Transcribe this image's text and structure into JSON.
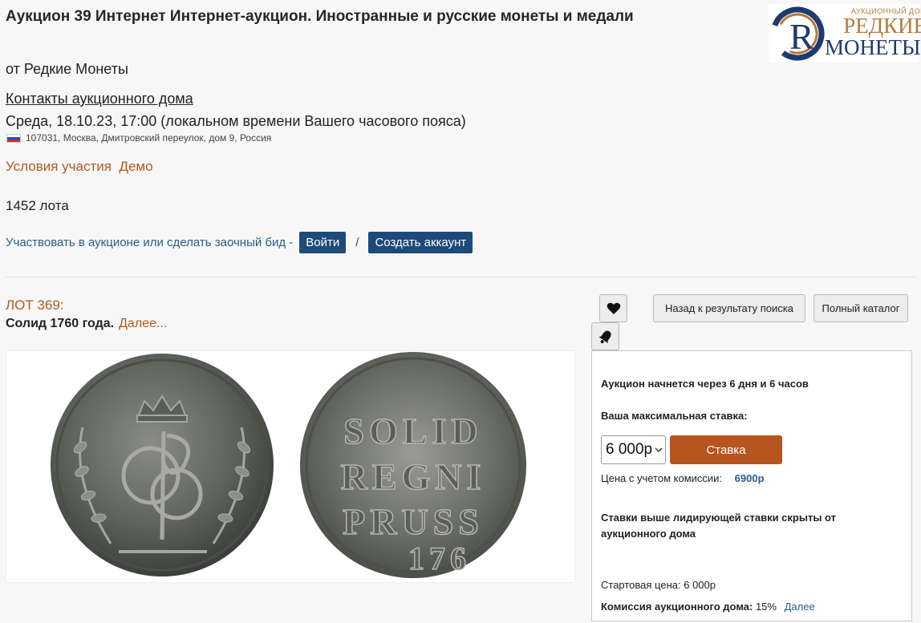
{
  "auction": {
    "title": "Аукцион 39 Интернет Интернет-аукцион. Иностранные и русские монеты и медали",
    "by": "от Редкие Монеты",
    "contacts_link": "Контакты аукционного дома",
    "date": "Среда, 18.10.23, 17:00 (локальном времени Вашего часового пояса)",
    "address": "107031, Москва, Дмитровский переулок, дом 9, Россия",
    "terms_link": "Условия участия",
    "demo_link": "Демо",
    "lots_count": "1452 лота",
    "participate_text": "Участвовать в аукционе или сделать заочный бид -",
    "login_button": "Войти",
    "slash": "/",
    "create_account_button": "Создать аккаунт"
  },
  "logo": {
    "small": "АУКЦИОННЫЙ ДОМ",
    "line1": "РЕДКИЕ",
    "line2": "МОНЕТЫ",
    "reg": "®",
    "letter": "R"
  },
  "lot": {
    "number": "ЛОТ 369:",
    "title": "Солид 1760 года.",
    "more": "Далее...",
    "coin_reverse_text": [
      "SOLID",
      "REGNI",
      "PRUSS",
      "176"
    ]
  },
  "actions": {
    "back_to_search": "Назад к результату поиска",
    "full_catalog": "Полный каталог"
  },
  "bid": {
    "starts_in": "Аукцион начнется через 6 дня и 6 часов",
    "max_bid_label": "Ваша максимальная ставка:",
    "selected_amount": "6 000р",
    "bid_button": "Ставка",
    "price_with_commission_label": "Цена с учетом комиссии:",
    "price_with_commission_value": "6900р",
    "hidden_note": "Ставки выше лидирующей ставки скрыты от аукционного дома",
    "start_price_label": "Стартовая цена:",
    "start_price_value": "6 000р",
    "commission_label": "Комиссия аукционного дома:",
    "commission_value": "15%",
    "commission_more": "Далее"
  },
  "colors": {
    "brown_link": "#b05a1e",
    "blue_button": "#1e4a7a",
    "bid_button": "#b8541f",
    "blue_text": "#2a5c8a"
  }
}
